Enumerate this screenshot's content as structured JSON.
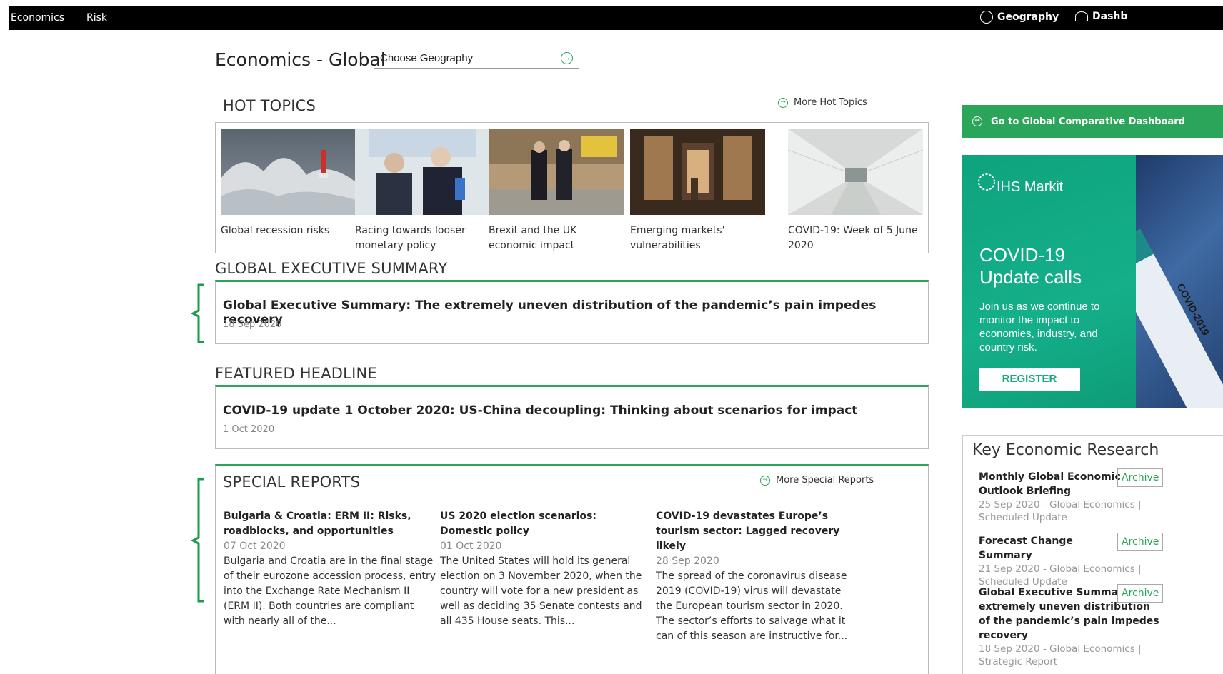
{
  "topnav": {
    "left_items": [
      {
        "label": "Economics"
      },
      {
        "label": "Risk"
      }
    ],
    "geography": {
      "label": "Geography",
      "icon": "globe-icon"
    },
    "dashboard": {
      "label": "Dashb",
      "icon": "dashboard-icon"
    }
  },
  "header": {
    "title": "Economics - Global",
    "geography_select": {
      "value": "Choose Geography"
    }
  },
  "hot_topics": {
    "heading": "HOT TOPICS",
    "more_label": "More Hot Topics",
    "items": [
      {
        "caption": "Global recession risks",
        "image": "storm-lighthouse"
      },
      {
        "caption": "Racing towards looser monetary policy",
        "image": "central-bankers"
      },
      {
        "caption": "Brexit and the UK economic impact",
        "image": "politicians-walking"
      },
      {
        "caption": "Emerging markets' vulnerabilities",
        "image": "shop-doorway"
      },
      {
        "caption": "COVID-19: Week of 5 June 2020",
        "image": "empty-shelves"
      }
    ]
  },
  "executive_summary": {
    "heading": "GLOBAL EXECUTIVE SUMMARY",
    "title": "Global Executive Summary: The extremely uneven distribution of the pandemic’s pain impedes recovery",
    "date": "18 Sep 2020"
  },
  "featured": {
    "heading": "FEATURED HEADLINE",
    "title": "COVID-19 update 1 October 2020: US-China decoupling: Thinking about scenarios for impact",
    "date": "1 Oct 2020"
  },
  "special_reports": {
    "heading": "SPECIAL REPORTS",
    "more_label": "More Special Reports",
    "items": [
      {
        "title": "Bulgaria & Croatia: ERM II: Risks, roadblocks, and opportunities",
        "date": "07 Oct 2020",
        "summary": "Bulgaria and Croatia are in the final stage of their eurozone accession process, entry into the Exchange Rate Mechanism II (ERM II). Both countries are compliant with nearly all of the..."
      },
      {
        "title": "US 2020 election scenarios: Domestic policy",
        "date": "01 Oct 2020",
        "summary": "The United States will hold its general election on 3 November 2020, when the country will vote for a new president as well as deciding 35 Senate contests and all 435 House seats. This..."
      },
      {
        "title": "COVID-19 devastates Europe’s tourism sector: Lagged recovery likely",
        "date": "28 Sep 2020",
        "summary": "The spread of the coronavirus disease 2019 (COVID-19) virus will devastate the European tourism sector in 2020. The sector’s efforts to salvage what it can of this season are instructive for..."
      }
    ]
  },
  "sidebar": {
    "dashboard_cta": "Go to Global Comparative Dashboard",
    "ad": {
      "brand": "IHS Markit",
      "headline_line1": "COVID-19",
      "headline_line2": "Update calls",
      "body": "Join us as we continue to monitor the impact to economies, industry, and country risk.",
      "button": "REGISTER",
      "tube_label": "COVID-2019"
    },
    "key_research": {
      "heading": "Key Economic Research",
      "archive_label": "Archive",
      "items": [
        {
          "title": "Monthly Global Economic Outlook Briefing",
          "meta": "25 Sep 2020 - Global Economics | Scheduled Update"
        },
        {
          "title": "Forecast Change Summary",
          "meta": "21 Sep 2020 - Global Economics | Scheduled Update"
        },
        {
          "title": "Global Executive Summary: The extremely uneven distribution of the pandemic’s pain impedes recovery",
          "meta": "18 Sep 2020 - Global Economics | Strategic Report"
        }
      ]
    }
  },
  "colors": {
    "accent": "#2aa55a",
    "topbar": "#000000",
    "ad_green": "#14b08a"
  }
}
